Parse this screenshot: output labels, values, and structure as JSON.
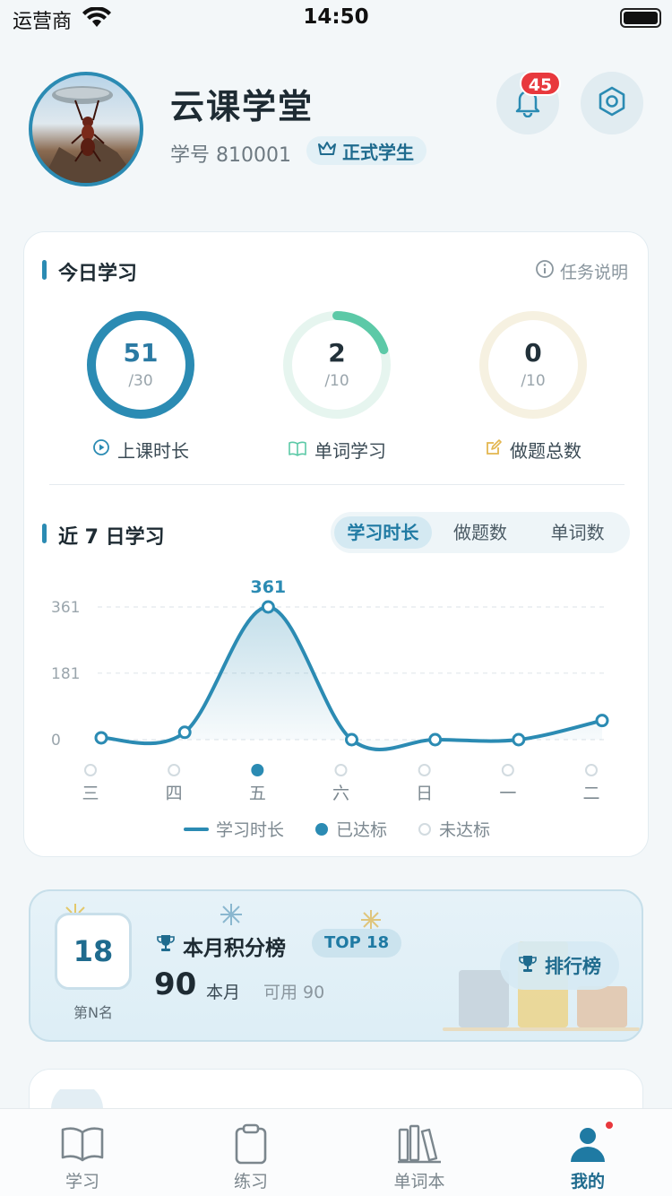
{
  "status_bar": {
    "carrier": "运营商",
    "time": "14:50"
  },
  "profile": {
    "app_name": "云课学堂",
    "student_id": "学号 810001",
    "badge": "正式学生",
    "notification_count": "45"
  },
  "today": {
    "title": "今日学习",
    "help": "任务说明",
    "stats": [
      {
        "value": "51",
        "goal": "/30",
        "label": "上课时长",
        "progress": 1.0,
        "color": "#2b8bb3"
      },
      {
        "value": "2",
        "goal": "/10",
        "label": "单词学习",
        "progress": 0.2,
        "color": "#5cc9a7"
      },
      {
        "value": "0",
        "goal": "/10",
        "label": "做题总数",
        "progress": 0.0,
        "color": "#e3b64f"
      }
    ]
  },
  "week": {
    "title": "近 7 日学习",
    "tabs": [
      "学习时长",
      "做题数",
      "单词数"
    ],
    "active_tab": 0
  },
  "chart_data": {
    "type": "line",
    "categories": [
      "三",
      "四",
      "五",
      "六",
      "日",
      "一",
      "二"
    ],
    "series": [
      {
        "name": "学习时长",
        "values": [
          5,
          20,
          361,
          0,
          0,
          0,
          52
        ]
      }
    ],
    "reached": [
      false,
      false,
      true,
      false,
      false,
      false,
      false
    ],
    "y_ticks": [
      "0",
      "181",
      "361"
    ],
    "ylim": [
      0,
      361
    ],
    "peak_label": "361",
    "legend": [
      "学习时长",
      "已达标",
      "未达标"
    ],
    "grid": true,
    "color": "#2b8bb3"
  },
  "rank": {
    "rank": "18",
    "caption": "第N名",
    "title": "本月积分榜",
    "top_badge": "TOP 18",
    "points": "90",
    "points_label": "本月",
    "available": "可用 90",
    "button": "排行榜"
  },
  "tabbar": {
    "items": [
      "学习",
      "练习",
      "单词本",
      "我的"
    ],
    "active": 3
  }
}
